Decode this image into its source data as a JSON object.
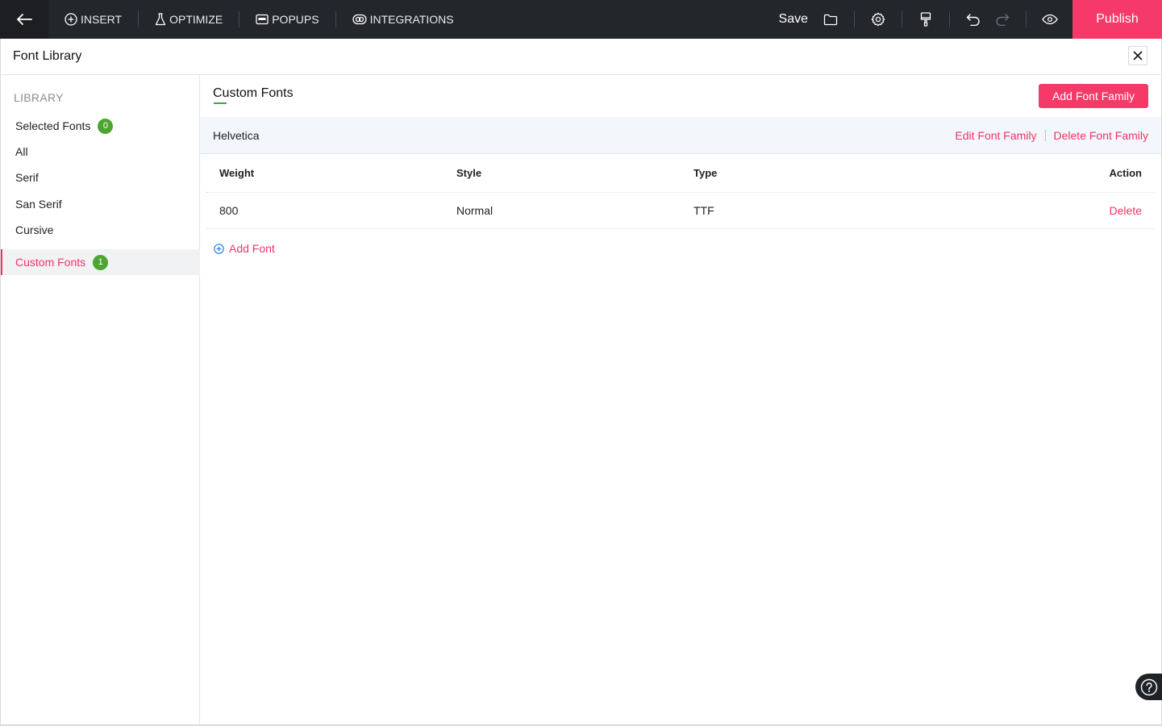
{
  "topbar": {
    "nav": [
      "INSERT",
      "OPTIMIZE",
      "POPUPS",
      "INTEGRATIONS"
    ],
    "save_label": "Save",
    "publish_label": "Publish"
  },
  "titlebar": {
    "title": "Font Library"
  },
  "sidebar": {
    "heading": "LIBRARY",
    "items": [
      {
        "label": "Selected Fonts",
        "badge": "0"
      },
      {
        "label": "All"
      },
      {
        "label": "Serif"
      },
      {
        "label": "San Serif"
      },
      {
        "label": "Cursive"
      },
      {
        "label": "Custom Fonts",
        "badge": "1",
        "active": true
      }
    ]
  },
  "main": {
    "title": "Custom Fonts",
    "add_family_label": "Add Font Family",
    "family": {
      "name": "Helvetica",
      "edit_label": "Edit Font Family",
      "delete_label": "Delete Font Family"
    },
    "table": {
      "headers": [
        "Weight",
        "Style",
        "Type",
        "Action"
      ],
      "rows": [
        {
          "weight": "800",
          "style": "Normal",
          "type": "TTF",
          "action": "Delete"
        }
      ]
    },
    "add_font_label": "Add Font"
  },
  "colors": {
    "accent": "#f53a6a",
    "badge": "#4ca531",
    "topbar": "#23262b"
  }
}
